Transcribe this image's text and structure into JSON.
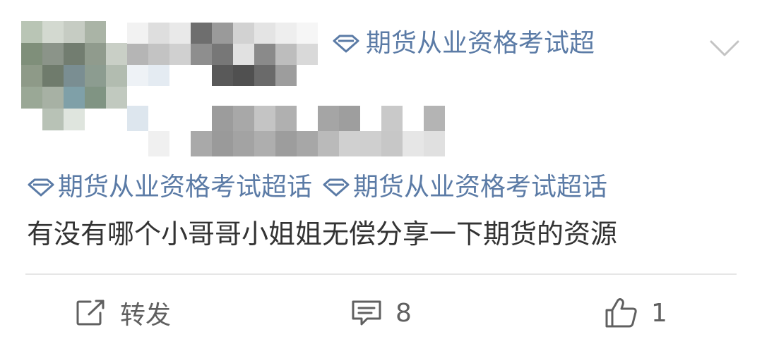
{
  "header": {
    "topic_tag": "期货从业资格考试超"
  },
  "post": {
    "tags": [
      "期货从业资格考试超话",
      "期货从业资格考试超话"
    ],
    "text": "有没有哪个小哥哥小姐姐无偿分享一下期货的资源"
  },
  "actions": {
    "repost_label": "转发",
    "comment_count": "8",
    "like_count": "1"
  },
  "colors": {
    "link": "#5b7ba6",
    "text": "#333333",
    "action": "#606060",
    "divider": "#e6e6e6"
  },
  "icons": {
    "topic": "gem-icon",
    "expand": "chevron-down-icon",
    "repost": "share-icon",
    "comment": "comment-icon",
    "like": "thumbs-up-icon"
  }
}
